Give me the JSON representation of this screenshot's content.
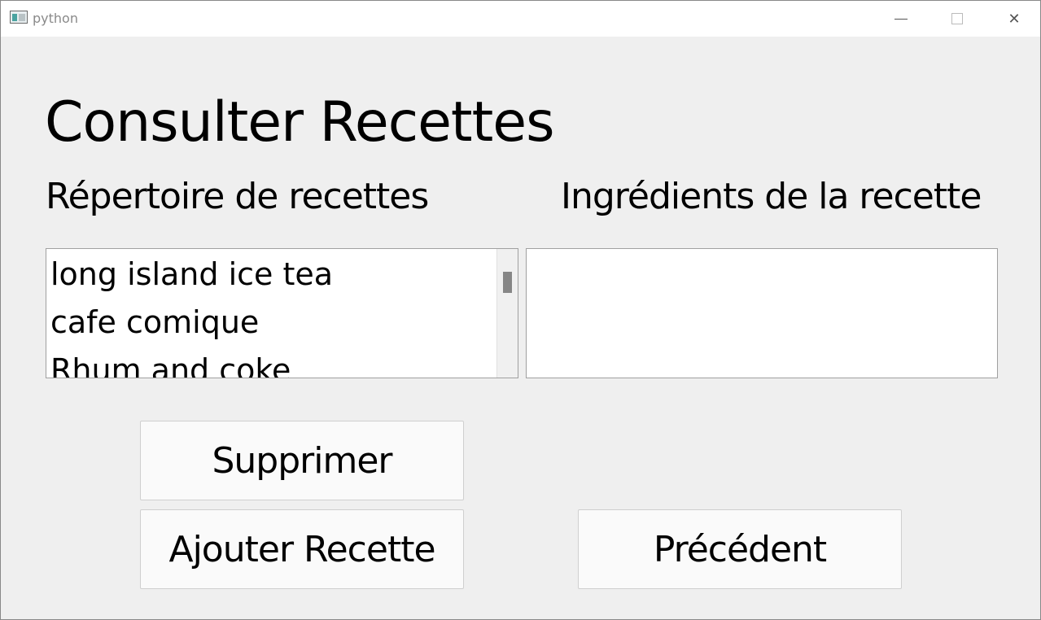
{
  "window": {
    "title": "python",
    "controls": {
      "minimize": "minimize-icon",
      "maximize": "maximize-icon",
      "close": "✕"
    }
  },
  "page": {
    "title": "Consulter Recettes",
    "left_label": "Répertoire de recettes",
    "right_label": "Ingrédients de la recette"
  },
  "recipes": {
    "items": [
      "long island ice tea",
      "cafe comique",
      "Rhum and coke"
    ]
  },
  "ingredients": {
    "value": ""
  },
  "buttons": {
    "delete": "Supprimer",
    "add": "Ajouter Recette",
    "previous": "Précédent"
  }
}
